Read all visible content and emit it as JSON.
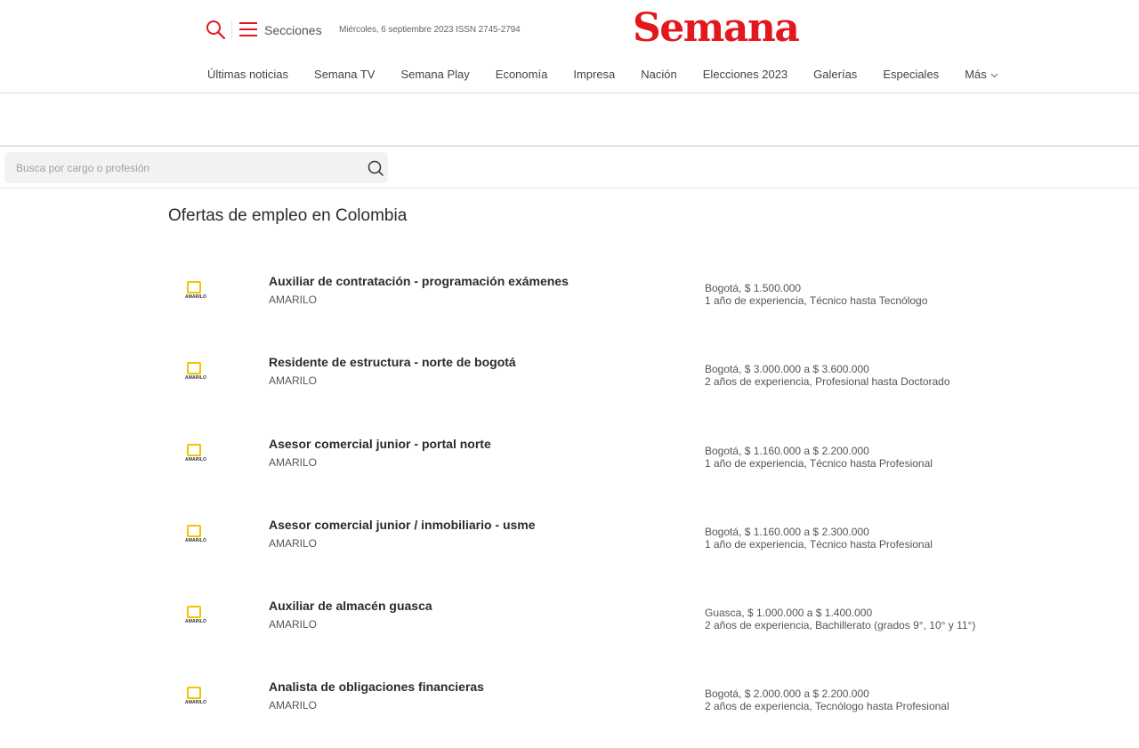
{
  "header": {
    "secciones_label": "Secciones",
    "date_text": "Miércoles, 6 septiembre 2023 ISSN 2745-2794",
    "logo_text": "Semana",
    "nav": [
      "Últimas noticias",
      "Semana TV",
      "Semana Play",
      "Economía",
      "Impresa",
      "Nación",
      "Elecciones 2023",
      "Galerías",
      "Especiales",
      "Más"
    ]
  },
  "search": {
    "placeholder": "Busca por cargo o profesión",
    "value": ""
  },
  "page_title": "Ofertas de empleo en Colombia",
  "jobs": [
    {
      "title": "Auxiliar de contratación - programación exámenes",
      "company": "AMARILO",
      "location_salary": "Bogotá, $ 1.500.000",
      "requirements": "1 año de experiencia, Técnico hasta Tecnólogo",
      "logo_text": "AMARILO"
    },
    {
      "title": "Residente de estructura - norte de bogotá",
      "company": "AMARILO",
      "location_salary": "Bogotá, $ 3.000.000 a $ 3.600.000",
      "requirements": "2 años de experiencia, Profesional hasta Doctorado",
      "logo_text": "AMARILO"
    },
    {
      "title": "Asesor comercial junior - portal norte",
      "company": "AMARILO",
      "location_salary": "Bogotá, $ 1.160.000 a $ 2.200.000",
      "requirements": "1 año de experiencia, Técnico hasta Profesional",
      "logo_text": "AMARILO"
    },
    {
      "title": "Asesor comercial junior / inmobiliario - usme",
      "company": "AMARILO",
      "location_salary": "Bogotá, $ 1.160.000 a $ 2.300.000",
      "requirements": "1 año de experiencia, Técnico hasta Profesional",
      "logo_text": "AMARILO"
    },
    {
      "title": "Auxiliar de almacén guasca",
      "company": "AMARILO",
      "location_salary": "Guasca, $ 1.000.000 a $ 1.400.000",
      "requirements": "2 años de experiencia, Bachillerato (grados 9°, 10° y 11°)",
      "logo_text": "AMARILO"
    },
    {
      "title": "Analista de obligaciones financieras",
      "company": "AMARILO",
      "location_salary": "Bogotá, $ 2.000.000 a $ 2.200.000",
      "requirements": "2 años de experiencia, Tecnólogo hasta Profesional",
      "logo_text": "AMARILO"
    }
  ],
  "colors": {
    "brand_red": "#e3181e",
    "logo_yellow": "#f2c400"
  },
  "icons": {
    "search": "search-icon",
    "menu": "hamburger-menu-icon",
    "more": "chevron-down-icon",
    "job_search": "search-icon"
  }
}
